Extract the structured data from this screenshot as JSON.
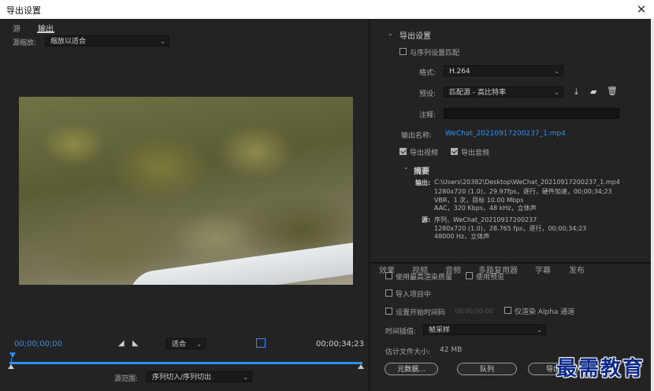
{
  "window": {
    "title": "导出设置",
    "close_glyph": "✕"
  },
  "left": {
    "tabs": [
      {
        "label": "源"
      },
      {
        "label": "输出"
      }
    ],
    "source_zoom": {
      "label": "源缩放:",
      "value": "缩放以适合"
    },
    "timecode_start": "00;00;00;00",
    "timecode_end": "00;00;34;23",
    "fit_value": "适合",
    "source_range": {
      "label": "源范围:",
      "value": "序列切入/序列切出"
    }
  },
  "right": {
    "export_settings": {
      "section_title": "导出设置",
      "match_sequence_label": "与序列设置匹配",
      "format_label": "格式:",
      "format_value": "H.264",
      "preset_label": "预设:",
      "preset_value": "匹配源 - 高比特率",
      "comment_label": "注释:",
      "comment_value": "",
      "output_name_label": "输出名称:",
      "output_name_value": "WeChat_20210917200237_1.mp4",
      "export_video_label": "导出视频",
      "export_audio_label": "导出音频",
      "export_video_checked": true,
      "export_audio_checked": true
    },
    "summary": {
      "title": "摘要",
      "output_label": "输出:",
      "output_lines": [
        "C:\\Users\\20382\\Desktop\\WeChat_20210917200237_1.mp4",
        "1280x720 (1.0)，29.97fps，逐行，硬件加速，00;00;34;23",
        "VBR，1 次，目标 10.00 Mbps",
        "AAC，320 Kbps，48  kHz，立体声"
      ],
      "source_label": "源:",
      "source_lines": [
        "序列，WeChat_20210917200237",
        "1280x720 (1.0)，28.765 fps，逐行，00;00;34;23",
        "48000 Hz，立体声"
      ]
    },
    "bottom_tabs": [
      "效果",
      "视频",
      "音频",
      "多路复用器",
      "字幕",
      "发布"
    ],
    "options": {
      "max_render_quality": "使用最高渲染质量",
      "use_previews": "使用预览",
      "import_into_project": "导入项目中",
      "set_start_timecode": "设置开始时间码",
      "start_timecode_value": "00;00;00;00",
      "render_alpha_only": "仅渲染 Alpha 通道",
      "time_interpolation_label": "时间插值:",
      "time_interpolation_value": "帧采样",
      "file_size_label": "估计文件大小:",
      "file_size_value": "42 MB"
    },
    "buttons": {
      "metadata": "元数据...",
      "queue": "队列",
      "export": "导出"
    }
  },
  "watermark": {
    "text": "最需教育"
  },
  "colors": {
    "accent_blue": "#2f8ff0",
    "background": "#232323"
  }
}
